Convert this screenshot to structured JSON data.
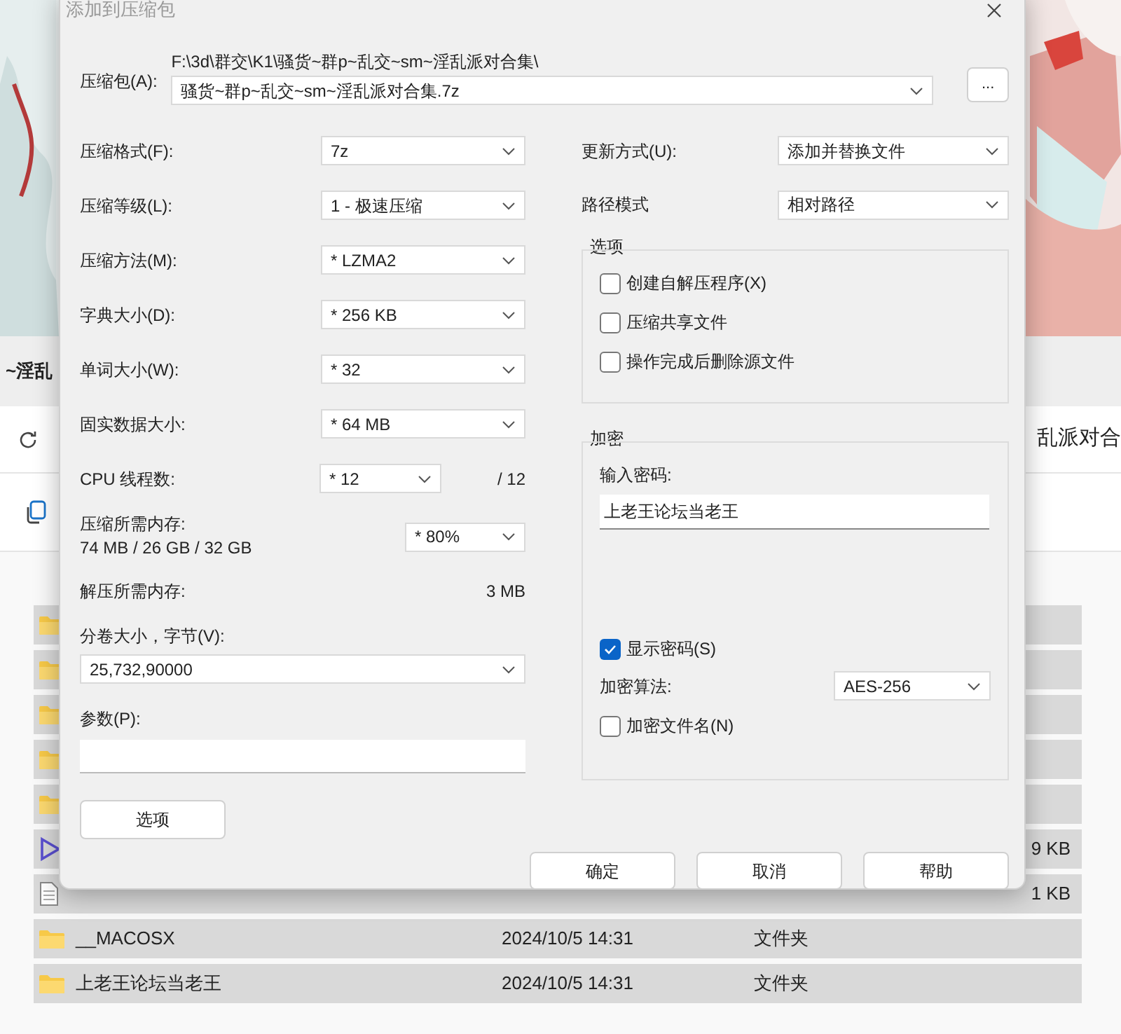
{
  "explorer": {
    "title": "~淫乱",
    "address": "乱派对合",
    "rows": [
      {
        "kind": "folder",
        "name": "",
        "date": "",
        "type": "",
        "size": ""
      },
      {
        "kind": "folder",
        "name": "",
        "date": "",
        "type": "",
        "size": ""
      },
      {
        "kind": "folder",
        "name": "",
        "date": "",
        "type": "",
        "size": ""
      },
      {
        "kind": "folder",
        "name": "",
        "date": "",
        "type": "",
        "size": ""
      },
      {
        "kind": "folder",
        "name": "",
        "date": "",
        "type": "",
        "size": ""
      },
      {
        "kind": "video",
        "name": "",
        "date": "",
        "type": "",
        "size": "9 KB"
      },
      {
        "kind": "text",
        "name": "",
        "date": "",
        "type": "",
        "size": "1 KB"
      },
      {
        "kind": "folder",
        "name": "__MACOSX",
        "date": "2024/10/5 14:31",
        "type": "文件夹",
        "size": ""
      },
      {
        "kind": "folder",
        "name": "上老王论坛当老王",
        "date": "2024/10/5 14:31",
        "type": "文件夹",
        "size": ""
      }
    ]
  },
  "dialog": {
    "title": "添加到压缩包",
    "archive": {
      "label": "压缩包(A):",
      "path": "F:\\3d\\群交\\K1\\骚货~群p~乱交~sm~淫乱派对合集\\",
      "value": "骚货~群p~乱交~sm~淫乱派对合集.7z",
      "browse": "..."
    },
    "left": [
      {
        "kind": "select",
        "label": "压缩格式(F):",
        "value": "7z"
      },
      {
        "kind": "select",
        "label": "压缩等级(L):",
        "value": "1 - 极速压缩"
      },
      {
        "kind": "select",
        "label": "压缩方法(M):",
        "value": "* LZMA2"
      },
      {
        "kind": "select",
        "label": "字典大小(D):",
        "value": "* 256 KB"
      },
      {
        "kind": "select",
        "label": "单词大小(W):",
        "value": "* 32"
      },
      {
        "kind": "select",
        "label": "固实数据大小:",
        "value": "* 64 MB"
      },
      {
        "kind": "threads",
        "label": "CPU 线程数:",
        "value": "* 12",
        "suffix": "/ 12"
      },
      {
        "kind": "memory",
        "label": "压缩所需内存:",
        "detail": "74 MB / 26 GB / 32 GB",
        "value": "* 80%"
      },
      {
        "kind": "info",
        "label": "解压所需内存:",
        "value": "3 MB"
      }
    ],
    "split": {
      "label": "分卷大小，字节(V):",
      "value": "25,732,90000"
    },
    "params": {
      "label": "参数(P):"
    },
    "options_button": "选项",
    "update": {
      "label": "更新方式(U):",
      "value": "添加并替换文件"
    },
    "path_mode": {
      "label": "路径模式",
      "value": "相对路径"
    },
    "options": {
      "title": "选项",
      "items": [
        {
          "label": "创建自解压程序(X)",
          "checked": false
        },
        {
          "label": "压缩共享文件",
          "checked": false
        },
        {
          "label": "操作完成后删除源文件",
          "checked": false
        }
      ]
    },
    "encryption": {
      "title": "加密",
      "password_label": "输入密码:",
      "password": "上老王论坛当老王",
      "show_password": {
        "label": "显示密码(S)",
        "checked": true
      },
      "method": {
        "label": "加密算法:",
        "value": "AES-256"
      },
      "encrypt_names": {
        "label": "加密文件名(N)",
        "checked": false
      }
    },
    "buttons": [
      "确定",
      "取消",
      "帮助"
    ]
  }
}
